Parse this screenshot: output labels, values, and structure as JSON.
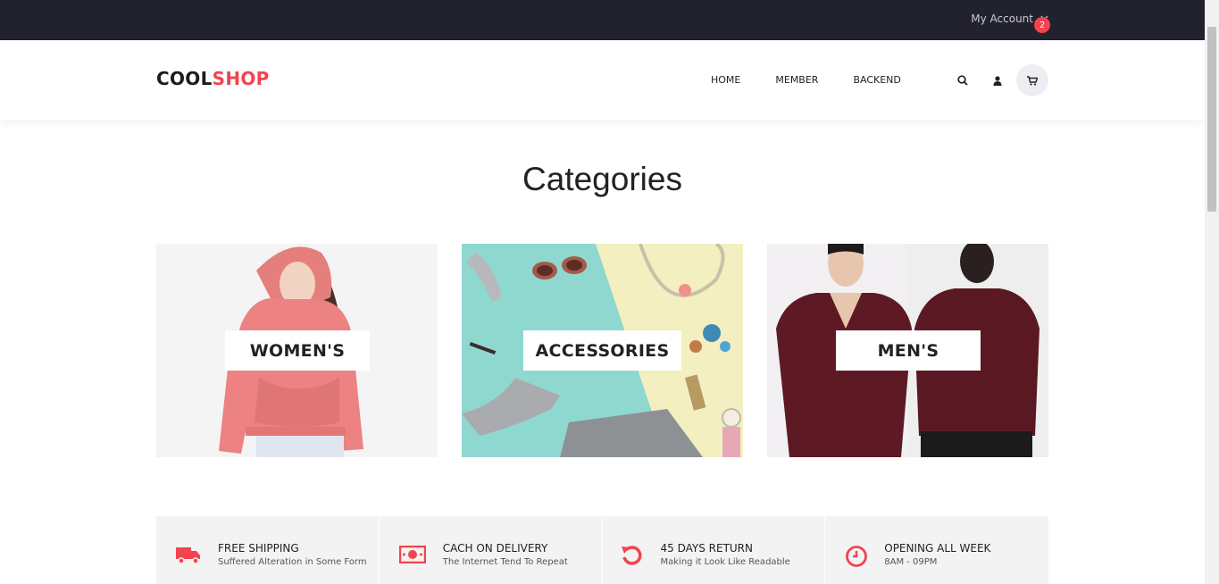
{
  "topbar": {
    "account_label": "My Account",
    "account_icon": "chevron-down-icon"
  },
  "header": {
    "logo_part1": "COOL",
    "logo_part2": "SHOP",
    "nav": [
      "HOME",
      "MEMBER",
      "BACKEND"
    ],
    "icons": [
      "search-icon",
      "user-icon",
      "cart-icon"
    ],
    "cart_count": "2"
  },
  "categories": {
    "title": "Categories",
    "items": [
      {
        "label": "WOMEN'S"
      },
      {
        "label": "ACCESSORIES"
      },
      {
        "label": "MEN'S"
      }
    ]
  },
  "features": [
    {
      "icon": "truck-icon",
      "title": "FREE SHIPPING",
      "subtitle": "Suffered Alteration in Some Form"
    },
    {
      "icon": "cash-icon",
      "title": "CACH ON DELIVERY",
      "subtitle": "The Internet Tend To Repeat"
    },
    {
      "icon": "return-icon",
      "title": "45 DAYS RETURN",
      "subtitle": "Making it Look Like Readable"
    },
    {
      "icon": "clock-icon",
      "title": "OPENING ALL WEEK",
      "subtitle": "8AM - 09PM"
    }
  ],
  "colors": {
    "accent": "#f2434f",
    "topbar": "#21222d",
    "feature_bg": "#f3f3f3"
  }
}
